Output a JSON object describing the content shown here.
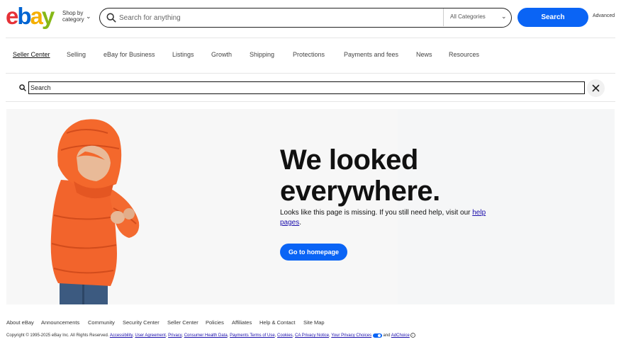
{
  "header": {
    "logo_letters": [
      "e",
      "b",
      "a",
      "y"
    ],
    "logo_colors": [
      "#e53238",
      "#0064d2",
      "#f5af02",
      "#86b817"
    ],
    "shop_by_category": "Shop by category",
    "search_placeholder": "Search for anything",
    "category_select": "All Categories",
    "search_button": "Search",
    "advanced_link": "Advanced"
  },
  "nav": {
    "items": [
      {
        "label": "Seller Center",
        "active": true
      },
      {
        "label": "Selling"
      },
      {
        "label": "eBay for Business"
      },
      {
        "label": "Listings"
      },
      {
        "label": "Growth"
      },
      {
        "label": "Shipping"
      },
      {
        "label": "Protections"
      },
      {
        "label": "Payments and fees"
      },
      {
        "label": "News"
      },
      {
        "label": "Resources"
      }
    ]
  },
  "secondary_search": {
    "placeholder": "Search"
  },
  "hero": {
    "headline_line1": "We looked",
    "headline_line2": "everywhere.",
    "subtext_prefix": "Looks like this page is missing. If you still need help, visit our ",
    "help_link": "help pages",
    "subtext_suffix": ".",
    "home_button": "Go to homepage",
    "accent_color": "#0a64f5"
  },
  "footer": {
    "links": [
      "About eBay",
      "Announcements",
      "Community",
      "Security Center",
      "Seller Center",
      "Policies",
      "Affiliates",
      "Help & Contact",
      "Site Map"
    ],
    "copyright_prefix": "Copyright © 1995-2025 eBay Inc. All Rights Reserved.",
    "legal_links": [
      "Accessibility",
      "User Agreement",
      "Privacy",
      "Consumer Health Data",
      "Payments Terms of Use",
      "Cookies",
      "CA Privacy Notice",
      "Your Privacy Choices"
    ],
    "and_text": "and",
    "adchoice": "AdChoice"
  }
}
